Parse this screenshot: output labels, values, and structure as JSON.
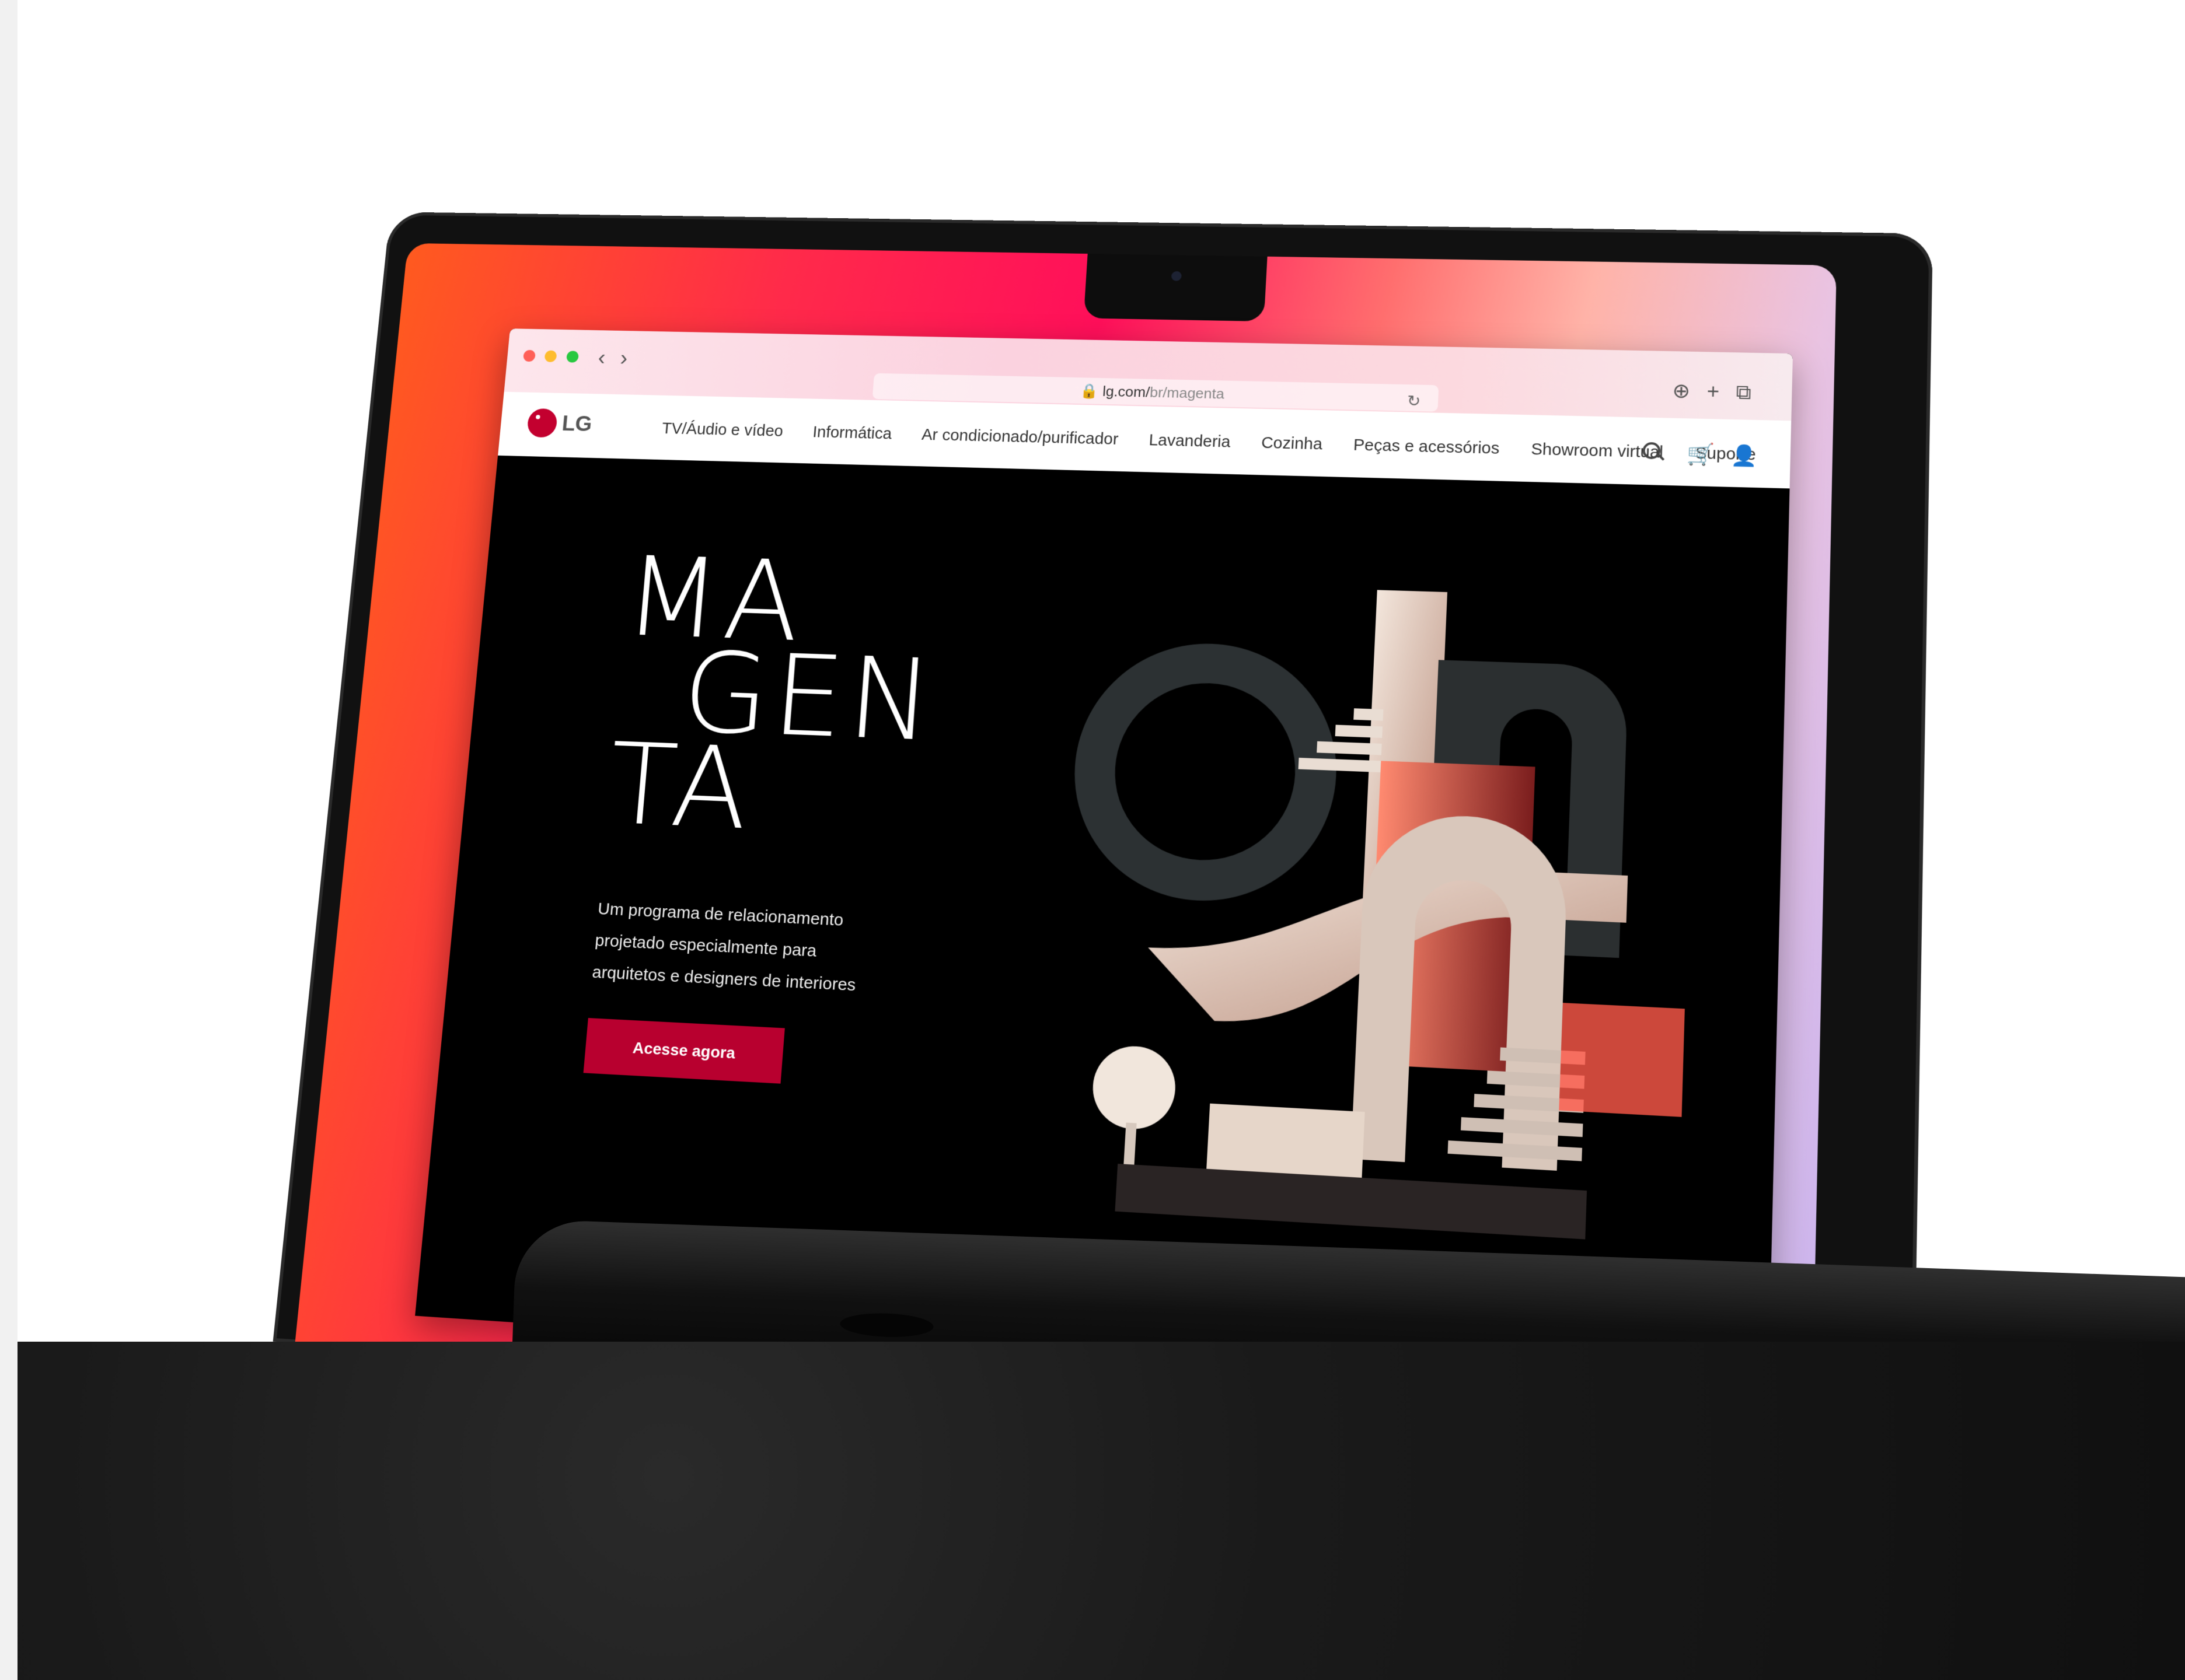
{
  "browser": {
    "address_domain": "lg.com/",
    "address_path": "br/magenta",
    "back_icon": "chevron-left-icon",
    "forward_icon": "chevron-right-icon"
  },
  "site": {
    "logo_text": "LG",
    "menu": [
      "TV/Áudio e vídeo",
      "Informática",
      "Ar condicionado/purificador",
      "Lavanderia",
      "Cozinha",
      "Peças e acessórios",
      "Showroom virtual",
      "Suporte"
    ]
  },
  "hero": {
    "wordmark_lines": [
      "MA",
      "GEN",
      "TA"
    ],
    "tagline": "Um programa de relacionamento projetado especialmente para arquitetos e designers de interiores",
    "cta_label": "Acesse agora"
  },
  "colors": {
    "brand": "#c3002f",
    "cta": "#b8002f",
    "hero_bg": "#000000"
  }
}
